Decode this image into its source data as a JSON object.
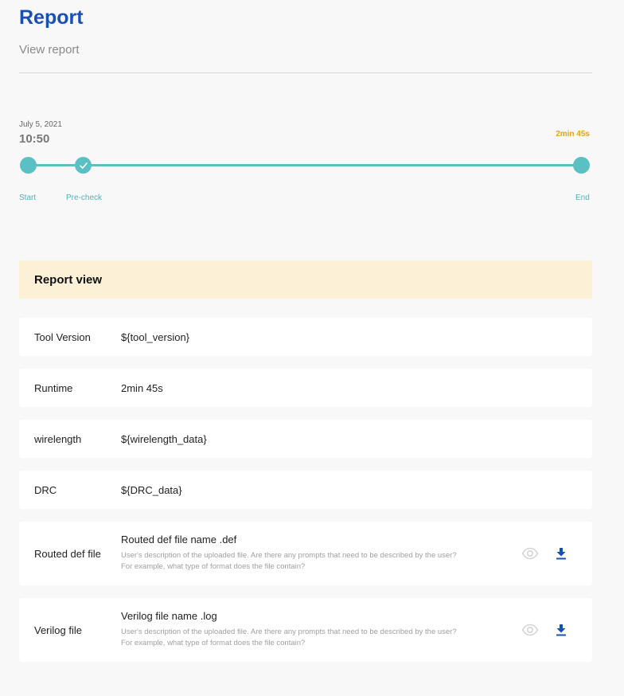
{
  "header": {
    "title": "Report",
    "subtitle": "View report"
  },
  "timeline": {
    "date": "July 5, 2021",
    "time": "10:50",
    "duration": "2min 45s",
    "steps": [
      {
        "label": "Start",
        "state": "done"
      },
      {
        "label": "Pre-check",
        "state": "checked"
      },
      {
        "label": "End",
        "state": "done"
      }
    ],
    "accent_color": "#5ac0c3",
    "duration_color": "#e8a317"
  },
  "report": {
    "title": "Report view",
    "rows": [
      {
        "label": "Tool Version",
        "value": "${tool_version}"
      },
      {
        "label": "Runtime",
        "value": "2min 45s"
      },
      {
        "label": "wirelength",
        "value": "${wirelength_data}"
      },
      {
        "label": "DRC",
        "value": "${DRC_data}"
      }
    ],
    "files": [
      {
        "label": "Routed def file",
        "file_name": "Routed def file name .def",
        "desc_line1": "User's description of the uploaded file. Are there any prompts that need to be described by the user?",
        "desc_line2": "For example, what type of  format does the file contain?",
        "view_icon": "eye-icon",
        "download_icon": "download-icon"
      },
      {
        "label": "Verilog file",
        "file_name": "Verilog file name .log",
        "desc_line1": "User's description of the uploaded file. Are there any prompts that need to be described by the user?",
        "desc_line2": "For example, what type of  format does the file contain?",
        "view_icon": "eye-icon",
        "download_icon": "download-icon"
      }
    ]
  },
  "colors": {
    "title": "#1a4fb5",
    "header_bg": "#fcf1d6",
    "download": "#1a4fb5"
  }
}
